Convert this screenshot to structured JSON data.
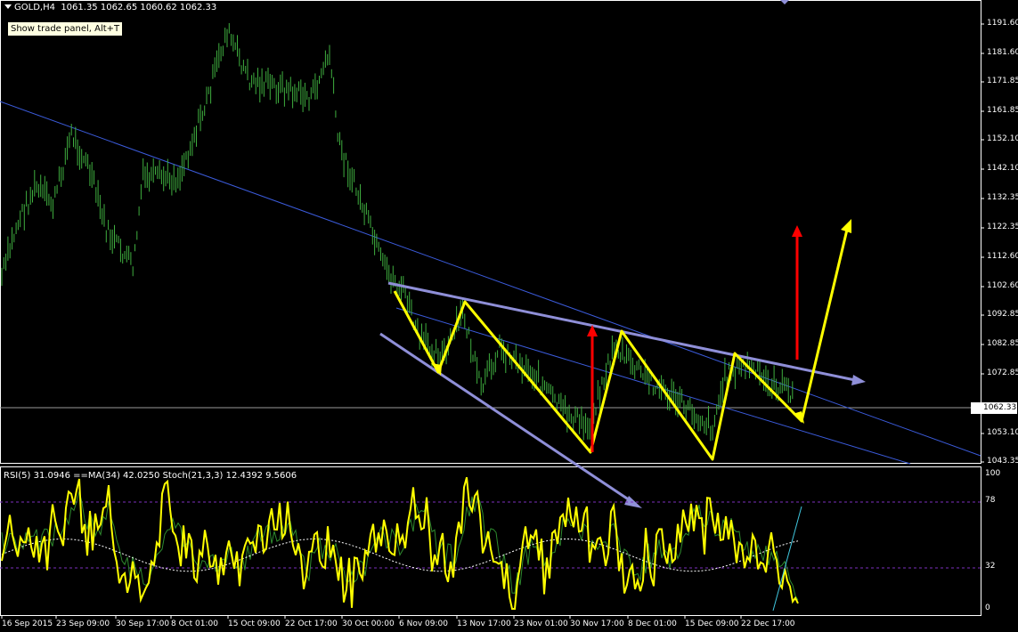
{
  "header": {
    "symbol": "GOLD,H4",
    "ohlc": "1061.35 1062.65 1060.62 1062.33"
  },
  "trade_panel_tooltip": "Show trade panel, Alt+T",
  "indicator_header": "RSI(5) 31.0946 ==MA(34) 42.0250 Stoch(21,3,3) 12.4392 9.5606",
  "price_axis": [
    "1191.60",
    "1181.60",
    "1171.85",
    "1161.85",
    "1152.10",
    "1142.10",
    "1132.35",
    "1122.35",
    "1112.60",
    "1102.60",
    "1092.85",
    "1082.85",
    "1072.85",
    "1062.33",
    "1053.10",
    "1043.35"
  ],
  "current_price": "1062.33",
  "indicator_axis": [
    "100",
    "78",
    "32",
    "0"
  ],
  "time_axis": [
    "16 Sep 2015",
    "23 Sep 09:00",
    "30 Sep 17:00",
    "8 Oct 01:00",
    "15 Oct 09:00",
    "22 Oct 17:00",
    "30 Oct 00:00",
    "6 Nov 09:00",
    "13 Nov 17:00",
    "23 Nov 01:00",
    "30 Nov 17:00",
    "8 Dec 01:00",
    "15 Dec 09:00",
    "22 Dec 17:00"
  ],
  "colors": {
    "background": "#000000",
    "candles": "#3fae3f",
    "trendline": "#3b5bdb",
    "channel": "#8f8fd8",
    "zigzag": "#ffff00",
    "signal_arrow": "#ff0000",
    "rsi": "#ffff00",
    "stoch": "#2e8b2e",
    "level": "#7b2fbe",
    "grid_axis": "#ffffff"
  }
}
